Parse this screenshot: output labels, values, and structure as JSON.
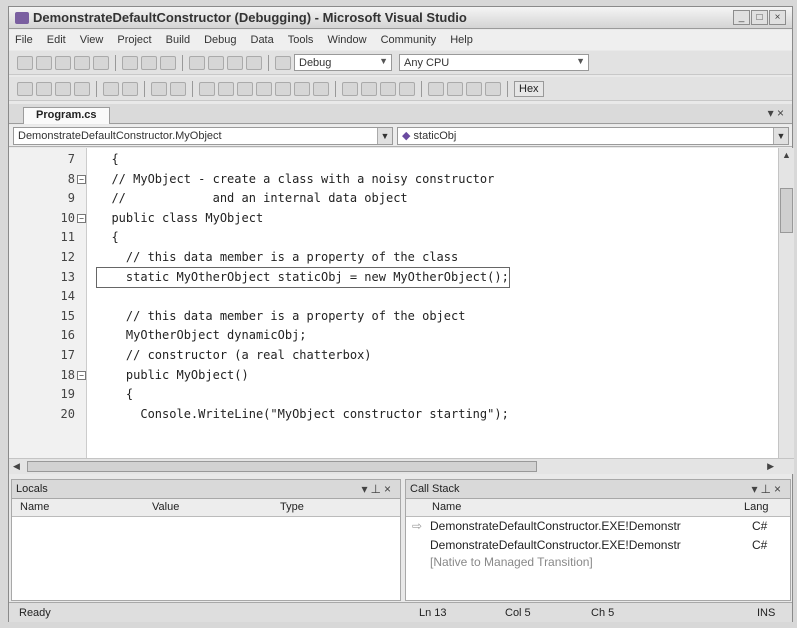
{
  "window": {
    "title": "DemonstrateDefaultConstructor (Debugging) - Microsoft Visual Studio"
  },
  "menu": [
    "File",
    "Edit",
    "View",
    "Project",
    "Build",
    "Debug",
    "Data",
    "Tools",
    "Window",
    "Community",
    "Help"
  ],
  "toolbar": {
    "config": "Debug",
    "platform": "Any CPU",
    "hex_label": "Hex"
  },
  "tab": {
    "label": "Program.cs"
  },
  "nav": {
    "type_combo": "DemonstrateDefaultConstructor.MyObject",
    "member_combo": "staticObj"
  },
  "code_lines": [
    {
      "num": "7",
      "fold": "",
      "text": "  {"
    },
    {
      "num": "8",
      "fold": "−",
      "text": "  // MyObject - create a class with a noisy constructor"
    },
    {
      "num": "9",
      "fold": "",
      "text": "  //            and an internal data object"
    },
    {
      "num": "10",
      "fold": "−",
      "text": "  public class MyObject"
    },
    {
      "num": "11",
      "fold": "",
      "text": "  {"
    },
    {
      "num": "12",
      "fold": "",
      "text": "    // this data member is a property of the class"
    },
    {
      "num": "13",
      "fold": "",
      "text": "    static MyOtherObject staticObj = new MyOtherObject();"
    },
    {
      "num": "14",
      "fold": "",
      "text": ""
    },
    {
      "num": "15",
      "fold": "",
      "text": "    // this data member is a property of the object"
    },
    {
      "num": "16",
      "fold": "",
      "text": "    MyOtherObject dynamicObj;"
    },
    {
      "num": "17",
      "fold": "",
      "text": "    // constructor (a real chatterbox)"
    },
    {
      "num": "18",
      "fold": "−",
      "text": "    public MyObject()"
    },
    {
      "num": "19",
      "fold": "",
      "text": "    {"
    },
    {
      "num": "20",
      "fold": "",
      "text": "      Console.WriteLine(\"MyObject constructor starting\");"
    }
  ],
  "current_line": "13",
  "locals": {
    "title": "Locals",
    "col_name": "Name",
    "col_value": "Value",
    "col_type": "Type"
  },
  "callstack": {
    "title": "Call Stack",
    "col_name": "Name",
    "col_lang": "Lang",
    "rows": [
      {
        "name": "DemonstrateDefaultConstructor.EXE!Demonstr",
        "lang": "C#"
      },
      {
        "name": "DemonstrateDefaultConstructor.EXE!Demonstr",
        "lang": "C#"
      },
      {
        "name": "[Native to Managed Transition]",
        "lang": ""
      }
    ]
  },
  "status": {
    "ready": "Ready",
    "ln": "Ln 13",
    "col": "Col 5",
    "ch": "Ch 5",
    "mode": "INS"
  }
}
